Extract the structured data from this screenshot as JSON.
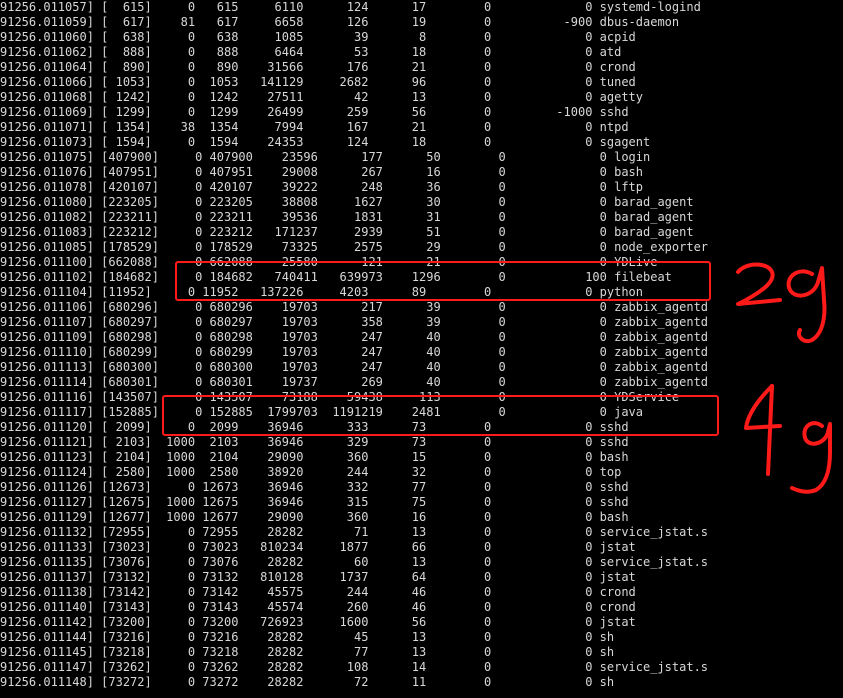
{
  "terminal": {
    "background": "#000000",
    "text_color": "#d8d8d8",
    "lines": [
      "91256.011057] [  615]     0   615     6110      124      17        0             0 systemd-logind",
      "91256.011059] [  617]    81   617     6658      126      19        0          -900 dbus-daemon",
      "91256.011060] [  638]     0   638     1085       39       8        0             0 acpid",
      "91256.011062] [  888]     0   888     6464       53      18        0             0 atd",
      "91256.011064] [  890]     0   890    31566      176      21        0             0 crond",
      "91256.011066] [ 1053]     0  1053   141129     2682      96        0             0 tuned",
      "91256.011068] [ 1242]     0  1242    27511       42      13        0             0 agetty",
      "91256.011069] [ 1299]     0  1299    26499      259      56        0         -1000 sshd",
      "91256.011071] [ 1354]    38  1354     7994      167      21        0             0 ntpd",
      "91256.011073] [ 1594]     0  1594    24353      124      18        0             0 sgagent",
      "91256.011075] [407900]     0 407900    23596      177      50        0             0 login",
      "91256.011076] [407951]     0 407951    29008      267      16        0             0 bash",
      "91256.011078] [420107]     0 420107    39222      248      36        0             0 lftp",
      "91256.011080] [223205]     0 223205    38808     1627      30        0             0 barad_agent",
      "91256.011082] [223211]     0 223211    39536     1831      31        0             0 barad_agent",
      "91256.011083] [223212]     0 223212   171237     2939      51        0             0 barad_agent",
      "91256.011085] [178529]     0 178529    73325     2575      29        0             0 node_exporter",
      "91256.011100] [662088]     0 662088    25580      121      21        0             0 YDLive",
      "91256.011102] [184682]     0 184682   740411   639973    1296        0           100 filebeat",
      "91256.011104] [11952]     0 11952   137226     4203      89        0             0 python",
      "91256.011106] [680296]     0 680296    19703      217      39        0             0 zabbix_agentd",
      "91256.011107] [680297]     0 680297    19703      358      39        0             0 zabbix_agentd",
      "91256.011109] [680298]     0 680298    19703      247      40        0             0 zabbix_agentd",
      "91256.011110] [680299]     0 680299    19703      247      40        0             0 zabbix_agentd",
      "91256.011113] [680300]     0 680300    19703      247      40        0             0 zabbix_agentd",
      "91256.011114] [680301]     0 680301    19737      269      40        0             0 zabbix_agentd",
      "91256.011116] [143507]     0 143507    73188    59438     113        0             0 YDService",
      "91256.011117] [152885]     0 152885  1799703  1191219    2481        0             0 java",
      "91256.011120] [ 2099]     0  2099    36946      333      73        0             0 sshd",
      "91256.011121] [ 2103]  1000  2103    36946      329      73        0             0 sshd",
      "91256.011123] [ 2104]  1000  2104    29090      360      15        0             0 bash",
      "91256.011124] [ 2580]  1000  2580    38920      244      32        0             0 top",
      "91256.011126] [12673]     0 12673    36946      332      77        0             0 sshd",
      "91256.011127] [12675]  1000 12675    36946      315      75        0             0 sshd",
      "91256.011129] [12677]  1000 12677    29090      360      16        0             0 bash",
      "91256.011132] [72955]     0 72955    28282       71      13        0             0 service_jstat.s",
      "91256.011133] [73023]     0 73023   810234     1877      66        0             0 jstat",
      "91256.011135] [73076]     0 73076    28282       60      13        0             0 service_jstat.s",
      "91256.011137] [73132]     0 73132   810128     1737      64        0             0 jstat",
      "91256.011138] [73142]     0 73142    45575      244      46        0             0 crond",
      "91256.011140] [73143]     0 73143    45574      260      46        0             0 crond",
      "91256.011142] [73200]     0 73200   726923     1600      56        0             0 jstat",
      "91256.011144] [73216]     0 73216    28282       45      13        0             0 sh",
      "91256.011145] [73218]     0 73218    28282       77      13        0             0 sh",
      "91256.011147] [73262]     0 73262    28282      108      14        0             0 service_jstat.s",
      "91256.011148] [73272]     0 73272    28282       72      11        0             0 sh"
    ]
  },
  "annotations": {
    "color": "#ff1a1a",
    "handwritten_labels": [
      "2g",
      "4g"
    ]
  }
}
